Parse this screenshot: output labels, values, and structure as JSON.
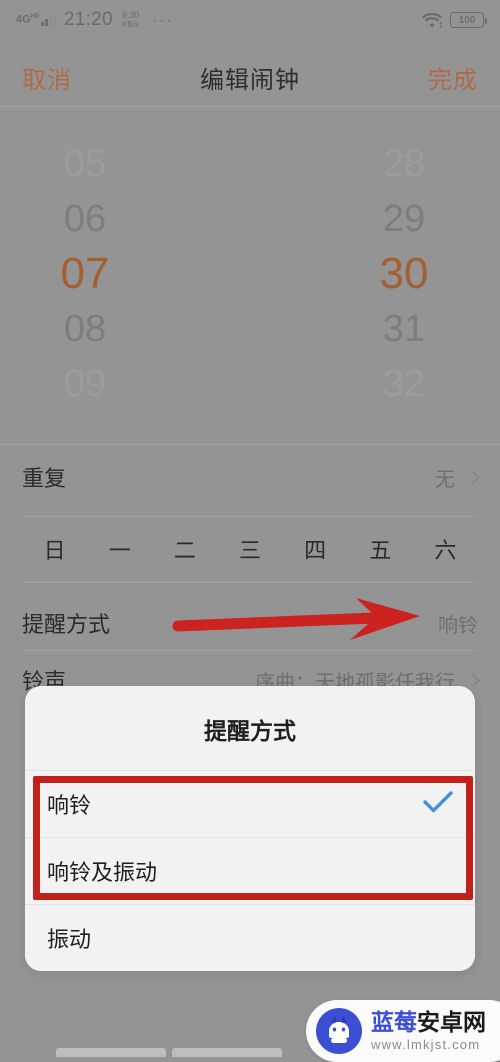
{
  "status_bar": {
    "network_type": "4G",
    "network_sup": "HD",
    "time": "21:20",
    "speed_value": "9.30",
    "speed_unit": "KB/s",
    "overflow": "···",
    "wifi_icon": "wifi-icon",
    "battery": "100"
  },
  "nav": {
    "cancel": "取消",
    "title": "编辑闹钟",
    "done": "完成"
  },
  "picker": {
    "hours": [
      "05",
      "06",
      "07",
      "08",
      "09"
    ],
    "minutes": [
      "28",
      "29",
      "30",
      "31",
      "32"
    ],
    "selected_hour": "07",
    "selected_minute": "30",
    "selected_color": "#a35f32"
  },
  "rows": {
    "repeat": {
      "label": "重复",
      "value": "无"
    },
    "remind": {
      "label": "提醒方式",
      "value": "响铃"
    },
    "ringtone": {
      "label": "铃声",
      "value": "序曲：天地孤影任我行"
    }
  },
  "weekdays": [
    "日",
    "一",
    "二",
    "三",
    "四",
    "五",
    "六"
  ],
  "dialog": {
    "title": "提醒方式",
    "options": [
      {
        "label": "响铃",
        "checked": true
      },
      {
        "label": "响铃及振动",
        "checked": false
      },
      {
        "label": "振动",
        "checked": false
      }
    ],
    "check_color": "#4a90d9"
  },
  "annotations": {
    "arrow_color": "#cc2220",
    "box_color": "#c0211d"
  },
  "watermark": {
    "name_part1": "蓝莓",
    "name_part2": "安卓网",
    "url": "www.lmkjst.com"
  }
}
